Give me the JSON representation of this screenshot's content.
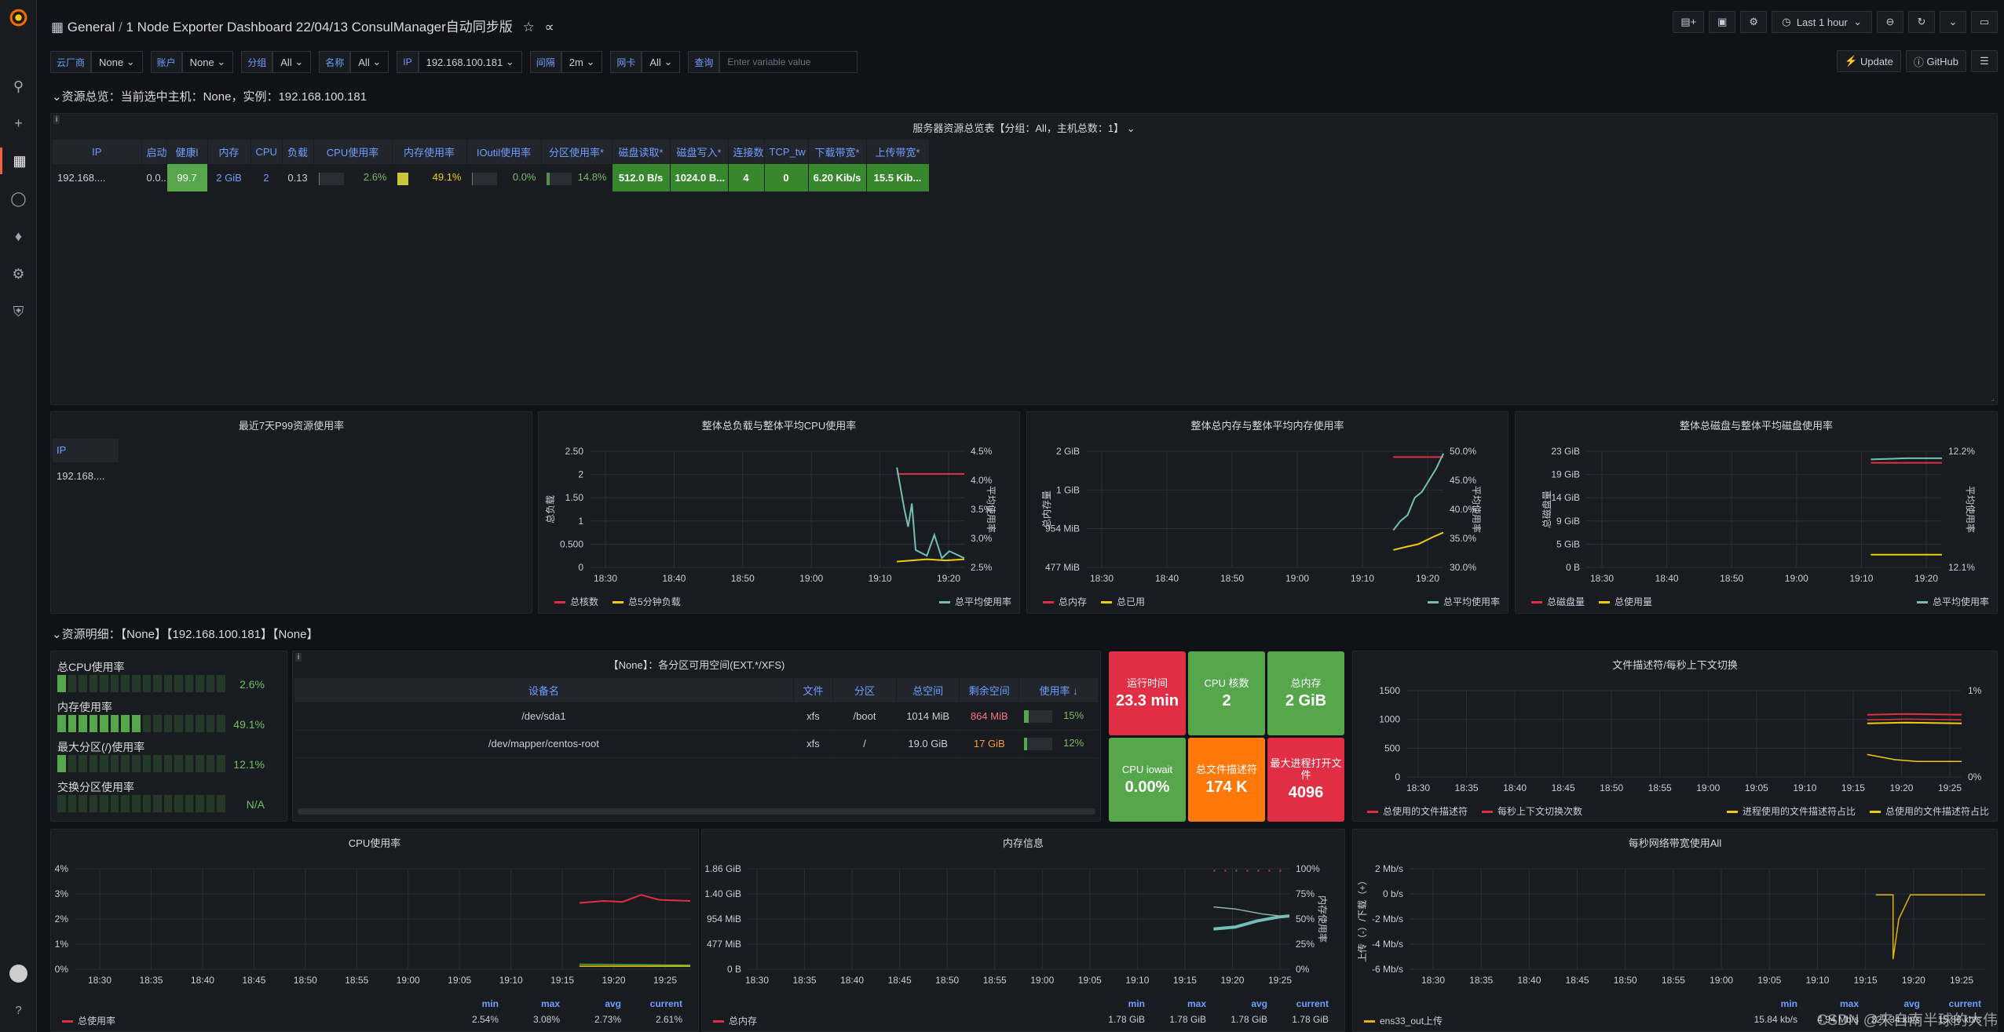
{
  "topbar": {
    "app": "General",
    "separator": "/",
    "dashboard_title": "1 Node Exporter Dashboard 22/04/13 ConsulManager自动同步版",
    "time_range": "Last 1 hour"
  },
  "variables": [
    {
      "label": "云厂商",
      "value": "None"
    },
    {
      "label": "账户",
      "value": "None"
    },
    {
      "label": "分组",
      "value": "All"
    },
    {
      "label": "名称",
      "value": "All"
    },
    {
      "label": "IP",
      "value": "192.168.100.181"
    },
    {
      "label": "间隔",
      "value": "2m"
    },
    {
      "label": "网卡",
      "value": "All"
    }
  ],
  "query": {
    "label": "查询",
    "placeholder": "Enter variable value"
  },
  "links": {
    "update": "Update",
    "github": "GitHub"
  },
  "row1": {
    "title": "资源总览：当前选中主机：None，实例：192.168.100.181"
  },
  "overview": {
    "title": "服务器资源总览表【分组：All，主机总数：1】",
    "headers": [
      "IP",
      "启动(",
      "健康l",
      "内存",
      "CPU",
      "负载",
      "CPU使用率",
      "内存使用率",
      "IOutil使用率",
      "分区使用率*",
      "磁盘读取*",
      "磁盘写入*",
      "连接数",
      "TCP_tw",
      "下载带宽*",
      "上传带宽*"
    ],
    "row": [
      "192.168....",
      "0.0...",
      "99.7",
      "2 GiB",
      "2",
      "0.13",
      "2.6%",
      "49.1%",
      "0.0%",
      "14.8%",
      "512.0 B/s",
      "1024.0 B...",
      "4",
      "0",
      "6.20 Kib/s",
      "15.5 Kib..."
    ],
    "fills": {
      "cpu": 0.026,
      "mem": 0.491,
      "io": 0.0,
      "part": 0.148
    }
  },
  "p99": {
    "title": "最近7天P99资源使用率",
    "header": "IP",
    "value": "192.168...."
  },
  "load_chart": {
    "title": "整体总负载与整体平均CPU使用率",
    "ylabel_left": "总负载",
    "ylabel_right": "平均使用率",
    "yticks": [
      "2.50",
      "2",
      "1.50",
      "1",
      "0.500",
      "0"
    ],
    "yticks_r": [
      "4.5%",
      "4.0%",
      "3.5%",
      "3.0%",
      "2.5%"
    ],
    "xticks": [
      "18:30",
      "18:40",
      "18:50",
      "19:00",
      "19:10",
      "19:20"
    ],
    "legend": [
      "总核数",
      "总5分钟负载",
      "总平均使用率"
    ]
  },
  "mem_chart": {
    "title": "整体总内存与整体平均内存使用率",
    "ylabel_left": "总内存量",
    "ylabel_right": "平均使用率",
    "yticks": [
      "2 GiB",
      "1 GiB",
      "954 MiB",
      "477 MiB"
    ],
    "yticks_r": [
      "50.0%",
      "45.0%",
      "40.0%",
      "35.0%",
      "30.0%"
    ],
    "xticks": [
      "18:30",
      "18:40",
      "18:50",
      "19:00",
      "19:10",
      "19:20"
    ],
    "legend": [
      "总内存",
      "总已用",
      "总平均使用率"
    ]
  },
  "disk_chart": {
    "title": "整体总磁盘与整体平均磁盘使用率",
    "ylabel_left": "总磁盘量",
    "ylabel_right": "平均使用率",
    "yticks": [
      "23 GiB",
      "19 GiB",
      "14 GiB",
      "9 GiB",
      "5 GiB",
      "0 B"
    ],
    "yticks_r": [
      "12.2%",
      "12.1%"
    ],
    "xticks": [
      "18:30",
      "18:40",
      "18:50",
      "19:00",
      "19:10",
      "19:20"
    ],
    "legend": [
      "总磁盘量",
      "总使用量",
      "总平均使用率"
    ]
  },
  "row2": {
    "title": "资源明细：【None】【192.168.100.181】【None】"
  },
  "bargauge": [
    {
      "label": "总CPU使用率",
      "value": "2.6%",
      "fraction": 0.026
    },
    {
      "label": "内存使用率",
      "value": "49.1%",
      "fraction": 0.491
    },
    {
      "label": "最大分区(/)使用率",
      "value": "12.1%",
      "fraction": 0.121
    },
    {
      "label": "交换分区使用率",
      "value": "N/A",
      "fraction": 0
    }
  ],
  "partitions": {
    "title": "【None】：各分区可用空间(EXT.*/XFS)",
    "headers": [
      "设备名",
      "文件",
      "分区",
      "总空间",
      "剩余空间",
      "使用率"
    ],
    "rows": [
      {
        "device": "/dev/sda1",
        "fs": "xfs",
        "mount": "/boot",
        "total": "1014 MiB",
        "free": "864 MiB",
        "used": "15%",
        "fraction": 0.15
      },
      {
        "device": "/dev/mapper/centos-root",
        "fs": "xfs",
        "mount": "/",
        "total": "19.0 GiB",
        "free": "17 GiB",
        "used": "12%",
        "fraction": 0.12
      }
    ]
  },
  "stats": [
    {
      "label": "运行时间",
      "value": "23.3 min",
      "color": "#e02f44"
    },
    {
      "label": "CPU 核数",
      "value": "2",
      "color": "#56a64b"
    },
    {
      "label": "总内存",
      "value": "2 GiB",
      "color": "#56a64b"
    },
    {
      "label": "CPU iowait",
      "value": "0.00%",
      "color": "#56a64b"
    },
    {
      "label": "总文件描述符",
      "value": "174 K",
      "color": "#ff780a"
    },
    {
      "label": "最大进程打开文件",
      "value": "4096",
      "color": "#e02f44"
    }
  ],
  "fd_chart": {
    "title": "文件描述符/每秒上下文切换",
    "yticks": [
      "1500",
      "1000",
      "500",
      "0"
    ],
    "yticks_r": [
      "1%",
      "0%"
    ],
    "xticks": [
      "18:30",
      "18:35",
      "18:40",
      "18:45",
      "18:50",
      "18:55",
      "19:00",
      "19:05",
      "19:10",
      "19:15",
      "19:20",
      "19:25"
    ],
    "legend": [
      "总使用的文件描述符",
      "每秒上下文切换次数",
      "进程使用的文件描述符占比",
      "总使用的文件描述符占比"
    ]
  },
  "cpu_chart": {
    "title": "CPU使用率",
    "yticks": [
      "4%",
      "3%",
      "2%",
      "1%",
      "0%"
    ],
    "xticks": [
      "18:30",
      "18:35",
      "18:40",
      "18:45",
      "18:50",
      "18:55",
      "19:00",
      "19:05",
      "19:10",
      "19:15",
      "19:20",
      "19:25"
    ],
    "stat_headers": [
      "min",
      "max",
      "avg",
      "current"
    ],
    "series": "总使用率",
    "stats": [
      "2.54%",
      "3.08%",
      "2.73%",
      "2.61%"
    ]
  },
  "meminfo_chart": {
    "title": "内存信息",
    "yticks": [
      "1.86 GiB",
      "1.40 GiB",
      "954 MiB",
      "477 MiB",
      "0 B"
    ],
    "yticks_r": [
      "100%",
      "75%",
      "50%",
      "25%",
      "0%"
    ],
    "ylabel_right": "内存使用率",
    "xticks": [
      "18:30",
      "18:35",
      "18:40",
      "18:45",
      "18:50",
      "18:55",
      "19:00",
      "19:05",
      "19:10",
      "19:15",
      "19:20",
      "19:25"
    ],
    "stat_headers": [
      "min",
      "max",
      "avg",
      "current"
    ],
    "series": "总内存",
    "stats": [
      "1.78 GiB",
      "1.78 GiB",
      "1.78 GiB",
      "1.78 GiB"
    ]
  },
  "net_chart": {
    "title": "每秒网络带宽使用All",
    "yticks": [
      "2 Mb/s",
      "0 b/s",
      "-2 Mb/s",
      "-4 Mb/s",
      "-6 Mb/s"
    ],
    "ylabel": "上传（-）/下载（+）",
    "xticks": [
      "18:30",
      "18:35",
      "18:40",
      "18:45",
      "18:50",
      "18:55",
      "19:00",
      "19:05",
      "19:10",
      "19:15",
      "19:20",
      "19:25"
    ],
    "stat_headers": [
      "min",
      "max",
      "avg",
      "current"
    ],
    "series": "ens33_out上传",
    "stats": [
      "15.84 kb/s",
      "4.94 Mb/s",
      "327.34 kb/s",
      "15.86 kb/s"
    ]
  },
  "watermark": "CSDN @来自南半球的大伟",
  "colors": {
    "red": "#e02f44",
    "yellow": "#f2cc0c",
    "cyan": "#73bfb8",
    "green": "#56a64b",
    "blue": "#6e9fff"
  }
}
